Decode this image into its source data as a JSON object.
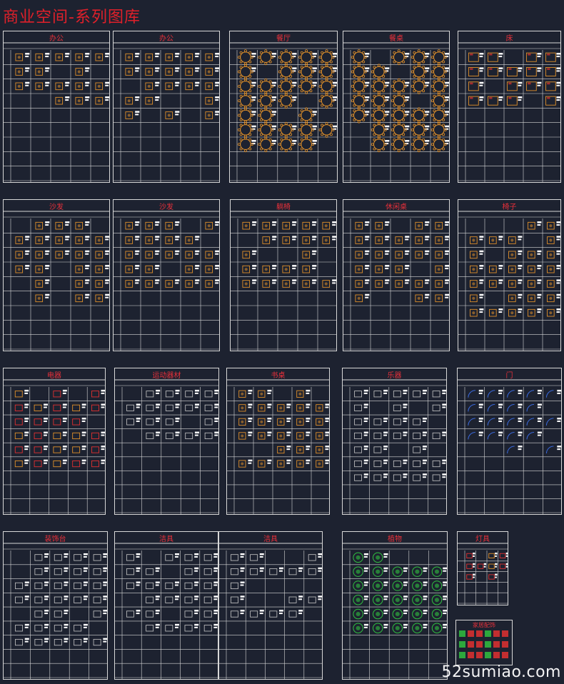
{
  "title": "商业空间-系列图库",
  "watermark": "52sumiao.com",
  "colors": {
    "background": "#1d2230",
    "line": "#d8d8d8",
    "title": "#e0202a",
    "furniture": "#e0902a",
    "plant": "#30c040",
    "symbol": "#3a6ae0"
  },
  "sheets": [
    {
      "label": "办公",
      "kind": "furniture"
    },
    {
      "label": "办公",
      "kind": "furniture"
    },
    {
      "label": "餐厅",
      "kind": "round"
    },
    {
      "label": "餐桌",
      "kind": "round"
    },
    {
      "label": "床",
      "kind": "bed"
    },
    {
      "label": "沙发",
      "kind": "furniture"
    },
    {
      "label": "沙发",
      "kind": "furniture"
    },
    {
      "label": "躺椅",
      "kind": "furniture"
    },
    {
      "label": "休闲桌",
      "kind": "furniture"
    },
    {
      "label": "椅子",
      "kind": "furniture"
    },
    {
      "label": "电器",
      "kind": "mixed"
    },
    {
      "label": "运动器材",
      "kind": "outline"
    },
    {
      "label": "书桌",
      "kind": "furniture"
    },
    {
      "label": "乐器",
      "kind": "outline"
    },
    {
      "label": "门",
      "kind": "door"
    },
    {
      "label": "装饰台",
      "kind": "outline"
    },
    {
      "label": "洁具",
      "kind": "outline"
    },
    {
      "label": "洁具",
      "kind": "outline"
    },
    {
      "label": "植物",
      "kind": "plant"
    },
    {
      "label": "灯具",
      "kind": "mixed"
    }
  ],
  "extra_title": "家居配饰"
}
